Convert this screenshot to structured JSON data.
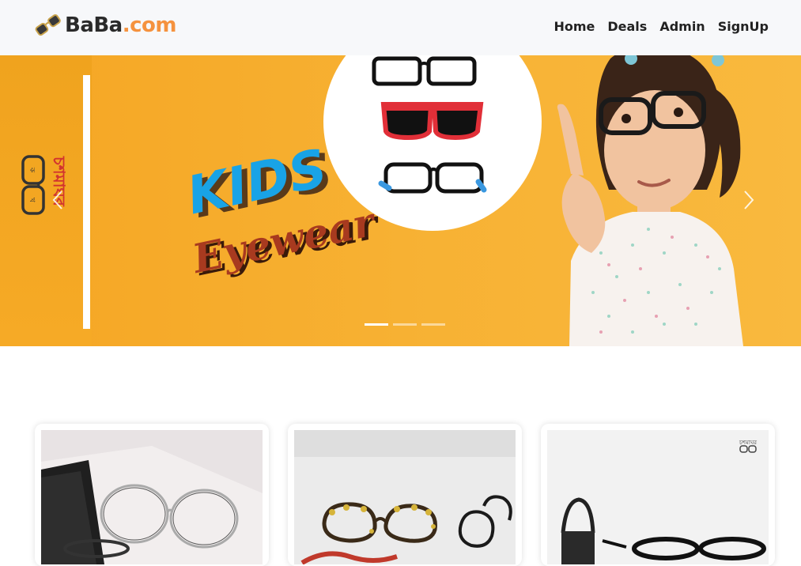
{
  "navbar": {
    "brand_name": "BaBa",
    "brand_domain": ".com",
    "links": [
      {
        "label": "Home"
      },
      {
        "label": "Deals"
      },
      {
        "label": "Admin"
      },
      {
        "label": "SignUp"
      }
    ]
  },
  "hero": {
    "headline": "KIDS",
    "subheadline": "Eyewear",
    "side_brand": "চশমাঘর",
    "active_slide": 1,
    "slide_count": 3,
    "prev_icon": "chevron-left-icon",
    "next_icon": "chevron-right-icon"
  },
  "products": {
    "cards": [
      {
        "image": "round-clear-frames-on-desk"
      },
      {
        "image": "tortoiseshell-cat-eye-frames"
      },
      {
        "image": "dark-frames-on-stand"
      }
    ],
    "card3_watermark": "চশমাঘর"
  },
  "colors": {
    "accent": "#f5923e",
    "hero_bg": "#f6b02f",
    "navbar_bg": "#f7f8fa"
  }
}
